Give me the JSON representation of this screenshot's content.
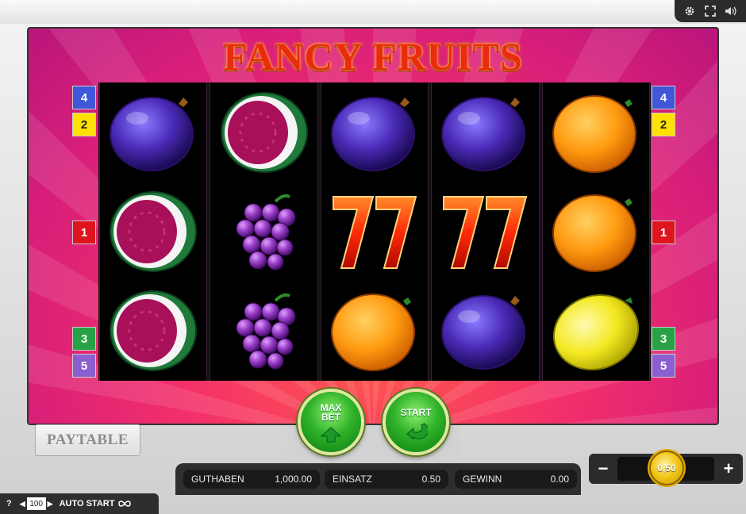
{
  "game": {
    "title": "FANCY FRUITS"
  },
  "lines": {
    "left": [
      "4",
      "2",
      "1",
      "3",
      "5"
    ],
    "right": [
      "4",
      "2",
      "1",
      "3",
      "5"
    ]
  },
  "reels": [
    [
      "plum",
      "watermelon",
      "watermelon"
    ],
    [
      "watermelon",
      "grapes",
      "grapes"
    ],
    [
      "plum",
      "seven",
      "orange"
    ],
    [
      "plum",
      "seven",
      "plum"
    ],
    [
      "orange",
      "orange",
      "lemon"
    ]
  ],
  "buttons": {
    "max_bet": "MAX BET",
    "max_bet_line1": "MAX",
    "max_bet_line2": "BET",
    "start": "START",
    "paytable": "PAYTABLE"
  },
  "status": {
    "balance_label": "GUTHABEN",
    "balance_value": "1,000.00",
    "stake_label": "EINSATZ",
    "stake_value": "0.50",
    "win_label": "GEWINN",
    "win_value": "0.00"
  },
  "bet": {
    "value": "0,50",
    "minus": "−",
    "plus": "+"
  },
  "autoplay": {
    "help": "?",
    "count": "100",
    "label": "AUTO START"
  },
  "icons": [
    "gear-icon",
    "fullscreen-icon",
    "speaker-icon",
    "infinity-icon"
  ],
  "colors": {
    "frame_pink": "#d61e7a",
    "frame_red": "#ff5a4a",
    "button_green": "#2fb22a",
    "coin_gold": "#f2c617"
  }
}
